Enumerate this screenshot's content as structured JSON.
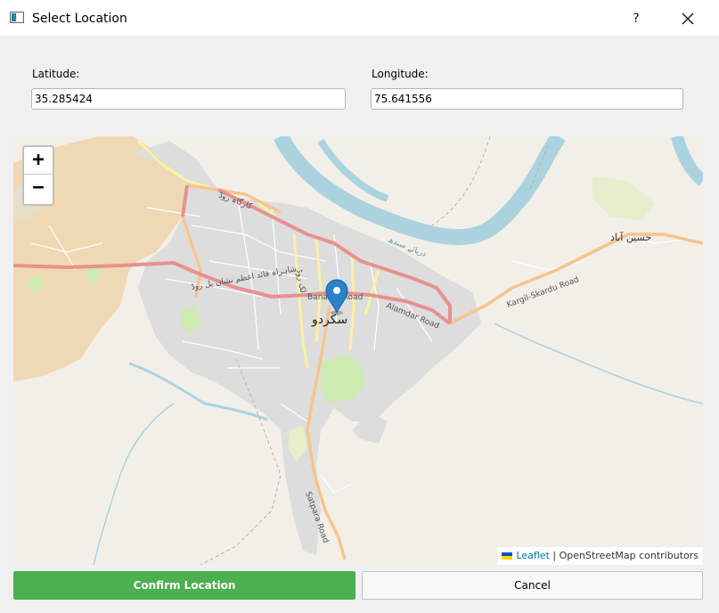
{
  "window": {
    "title": "Select Location",
    "help_label": "?",
    "app_icon": "window-icon",
    "close_icon": "close-icon"
  },
  "latitude": {
    "label": "Latitude:",
    "value": "35.285424"
  },
  "longitude": {
    "label": "Longitude:",
    "value": "75.641556"
  },
  "map": {
    "zoom_in_label": "+",
    "zoom_out_label": "−",
    "marker_icon": "map-pin-icon",
    "attribution": {
      "leaflet": "Leaflet",
      "separator": " | ",
      "osm": "OpenStreetMap contributors"
    },
    "place_labels": {
      "city": "سکردو",
      "hussainabad": "حسین آباد",
      "alamdar": "Alamdar Road",
      "kargil": "Kargil-Skardu Road",
      "banazar": "Banazar Road",
      "satpara": "Satpara Road",
      "indus": "دریائے سندھ",
      "lake": "لک روڈ",
      "quaid": "شاہراہ قائد اعظم نشان پل روڈ",
      "kargah": "کارگاہ روڈ"
    }
  },
  "buttons": {
    "confirm": "Confirm Location",
    "cancel": "Cancel"
  },
  "colors": {
    "confirm_bg": "#4caf50",
    "primary_road": "#e8918e",
    "secondary_road": "#f7c48d",
    "tertiary_road": "#f7f3a3",
    "water": "#aad3df",
    "residential": "#dddddd",
    "farmland": "#f0d8b2",
    "leaflet_link": "#0078a8"
  }
}
